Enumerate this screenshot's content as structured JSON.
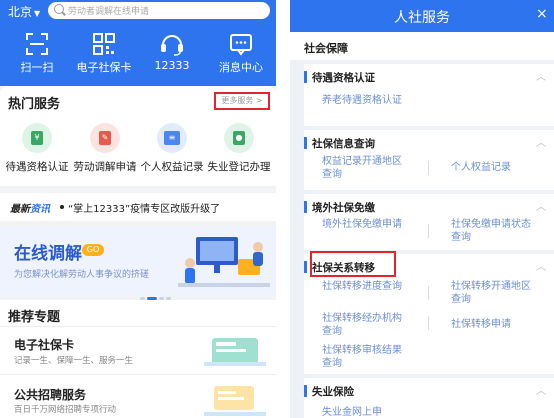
{
  "left": {
    "header": {
      "city": "北京",
      "search_placeholder": "劳动者调解在线申请",
      "quick_nav": [
        {
          "label": "扫一扫",
          "icon": "scan-icon"
        },
        {
          "label": "电子社保卡",
          "icon": "qr-code-icon"
        },
        {
          "label": "12333",
          "icon": "headset-icon"
        },
        {
          "label": "消息中心",
          "icon": "message-icon"
        }
      ]
    },
    "hot_services": {
      "title": "热门服务",
      "more": "更多服务 >",
      "items": [
        {
          "label": "待遇资格认证",
          "icon": "certification-icon",
          "color": "#3aa864"
        },
        {
          "label": "劳动调解申请",
          "icon": "mediation-icon",
          "color": "#e45b4c"
        },
        {
          "label": "个人权益记录",
          "icon": "record-icon",
          "color": "#4b86ee"
        },
        {
          "label": "失业登记办理",
          "icon": "unemployment-icon",
          "color": "#3aa864"
        }
      ]
    },
    "news": {
      "tag_a": "最新",
      "tag_b": "资讯",
      "text": "“掌上12333”疫情专区改版升级了"
    },
    "banner": {
      "title": "在线调解",
      "badge": "GO",
      "subtitle": "为您解决化解劳动人事争议的挤磋"
    },
    "recommended": {
      "title": "推荐专题",
      "topics": [
        {
          "title": "电子社保卡",
          "subtitle": "记录一生、保障一生、服务一生"
        },
        {
          "title": "公共招聘服务",
          "subtitle": "百日千万网络招聘专项行动"
        }
      ]
    }
  },
  "right": {
    "header": {
      "title": "人社服务",
      "close": "×"
    },
    "section": "社会保障",
    "groups": [
      {
        "title": "待遇资格认证",
        "items": [
          "养老待遇资格认证"
        ]
      },
      {
        "title": "社保信息查询",
        "items": [
          "权益记录开通地区查询",
          "个人权益记录"
        ]
      },
      {
        "title": "境外社保免缴",
        "items": [
          "境外社保免缴申请",
          "社保免缴申请状态查询"
        ]
      },
      {
        "title": "社保关系转移",
        "items": [
          "社保转移进度查询",
          "社保转移开通地区查询",
          "社保转移经办机构查询",
          "社保转移申请",
          "社保转移审核结果查询"
        ]
      },
      {
        "title": "失业保险",
        "items": [
          "失业金网上申"
        ]
      }
    ]
  },
  "colors": {
    "brand_blue": "#2d74ee",
    "highlight_red": "#e0262a",
    "link_blue": "#6b8fd6"
  }
}
